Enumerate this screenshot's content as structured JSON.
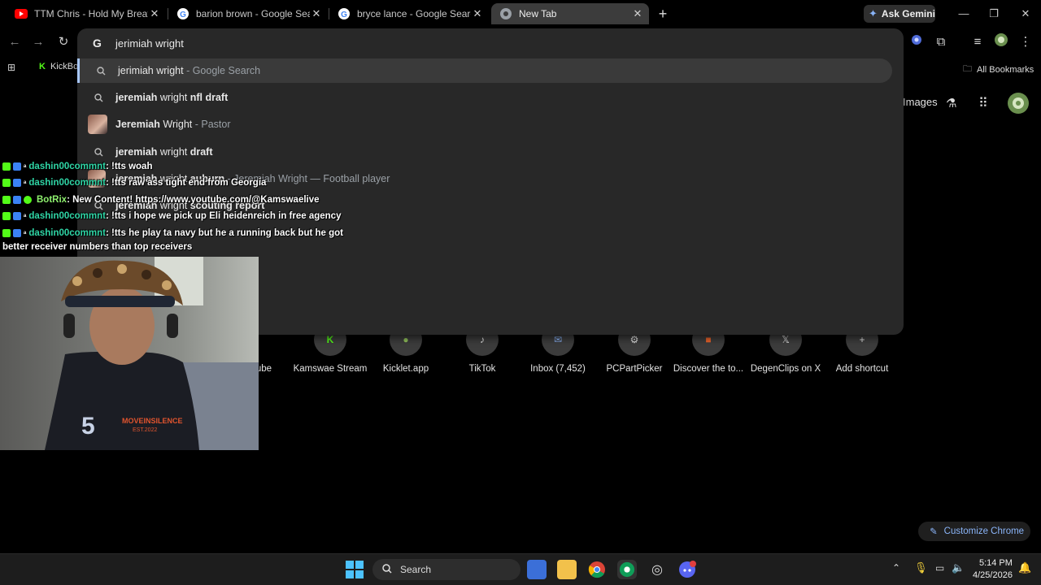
{
  "tabs": [
    {
      "label": "TTM Chris - Hold My Breath Ft",
      "favicon": "youtube-icon"
    },
    {
      "label": "barion brown - Google Search",
      "favicon": "google-icon"
    },
    {
      "label": "bryce lance - Google Search",
      "favicon": "google-icon"
    },
    {
      "label": "New Tab",
      "favicon": "chrome-icon",
      "active": true
    }
  ],
  "ask_gemini": "Ask Gemini",
  "bookmarks": {
    "first": "KickBo",
    "all": "All Bookmarks"
  },
  "omnibox": {
    "input": "jerimiah wright",
    "suggestions": [
      {
        "bold": "",
        "normal": "jerimiah wright",
        "sub": " - Google Search",
        "kind": "search",
        "selected": true
      },
      {
        "bold": "jeremiah",
        "normal": " wright ",
        "bold2": "nfl draft",
        "sub": "",
        "kind": "search"
      },
      {
        "bold": "Jeremiah",
        "normal": " Wright",
        "sub": " - Pastor",
        "kind": "entity"
      },
      {
        "bold": "jeremiah",
        "normal": " wright ",
        "bold2": "draft",
        "sub": "",
        "kind": "search"
      },
      {
        "bold": "jeremiah",
        "normal": " wright ",
        "bold2": "auburn",
        "sub": " - Jeremiah Wright — Football player",
        "kind": "entity"
      },
      {
        "bold": "jeremiah",
        "normal": " wright ",
        "bold2": "scouting report",
        "sub": "",
        "kind": "search"
      }
    ]
  },
  "ntp": {
    "images": "Images",
    "shortcuts": [
      {
        "label": "ube"
      },
      {
        "label": "Kamswae Stream"
      },
      {
        "label": "Kicklet.app"
      },
      {
        "label": "TikTok"
      },
      {
        "label": "Inbox (7,452)"
      },
      {
        "label": "PCPartPicker"
      },
      {
        "label": "Discover the to..."
      },
      {
        "label": "DegenClips on X"
      },
      {
        "label": "Add shortcut"
      }
    ],
    "customize": "Customize Chrome"
  },
  "chat": [
    {
      "user": "dashin00commnt",
      "msg": ": !tts woah"
    },
    {
      "user": "dashin00commnt",
      "msg": ": !tts raw ass tight end from Georgia"
    },
    {
      "user": "BotRix",
      "msg": ": New Content! https://www.youtube.com/@Kamswaelive",
      "bot": true
    },
    {
      "user": "dashin00commnt",
      "msg": ": !tts i hope we pick up Eli heidenreich in free agency"
    },
    {
      "user": "dashin00commnt",
      "msg": ": !tts he play ta navy but he a running back but he got"
    },
    {
      "user": "",
      "msg": "better receiver numbers than top receivers"
    }
  ],
  "webcam": {
    "shirt_text": "MOVEINSILENCE",
    "shirt_sub": "EST.2022",
    "shirt_number": "5"
  },
  "taskbar": {
    "search": "Search",
    "time": "5:14 PM",
    "date": "4/25/2026"
  },
  "colors": {
    "accent": "#a8c7fa",
    "chat_user": "#2fd6a6"
  }
}
